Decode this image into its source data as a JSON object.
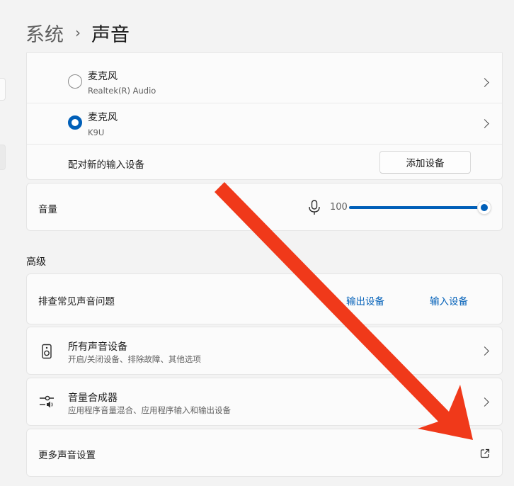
{
  "breadcrumb": {
    "parent": "系统",
    "separator": "›",
    "current": "声音"
  },
  "input_devices": [
    {
      "name": "麦克风",
      "subtitle": "Realtek(R) Audio",
      "selected": false
    },
    {
      "name": "麦克风",
      "subtitle": "K9U",
      "selected": true
    }
  ],
  "pair_row": {
    "label": "配对新的输入设备",
    "button": "添加设备"
  },
  "volume": {
    "label": "音量",
    "value": "100",
    "level_percent": 100,
    "icon": "microphone-icon"
  },
  "advanced": {
    "title": "高级",
    "troubleshoot": {
      "label": "排查常见声音问题",
      "link_output": "输出设备",
      "link_input": "输入设备"
    },
    "all_devices": {
      "title": "所有声音设备",
      "subtitle": "开启/关闭设备、排除故障、其他选项",
      "icon": "speaker-icon"
    },
    "mixer": {
      "title": "音量合成器",
      "subtitle": "应用程序音量混合、应用程序输入和输出设备",
      "icon": "mixer-icon"
    },
    "more": {
      "label": "更多声音设置",
      "icon": "external-link-icon"
    }
  },
  "colors": {
    "accent": "#005fb8",
    "arrow": "#f0391a",
    "background": "#f3f3f3",
    "card": "#fbfbfb"
  }
}
